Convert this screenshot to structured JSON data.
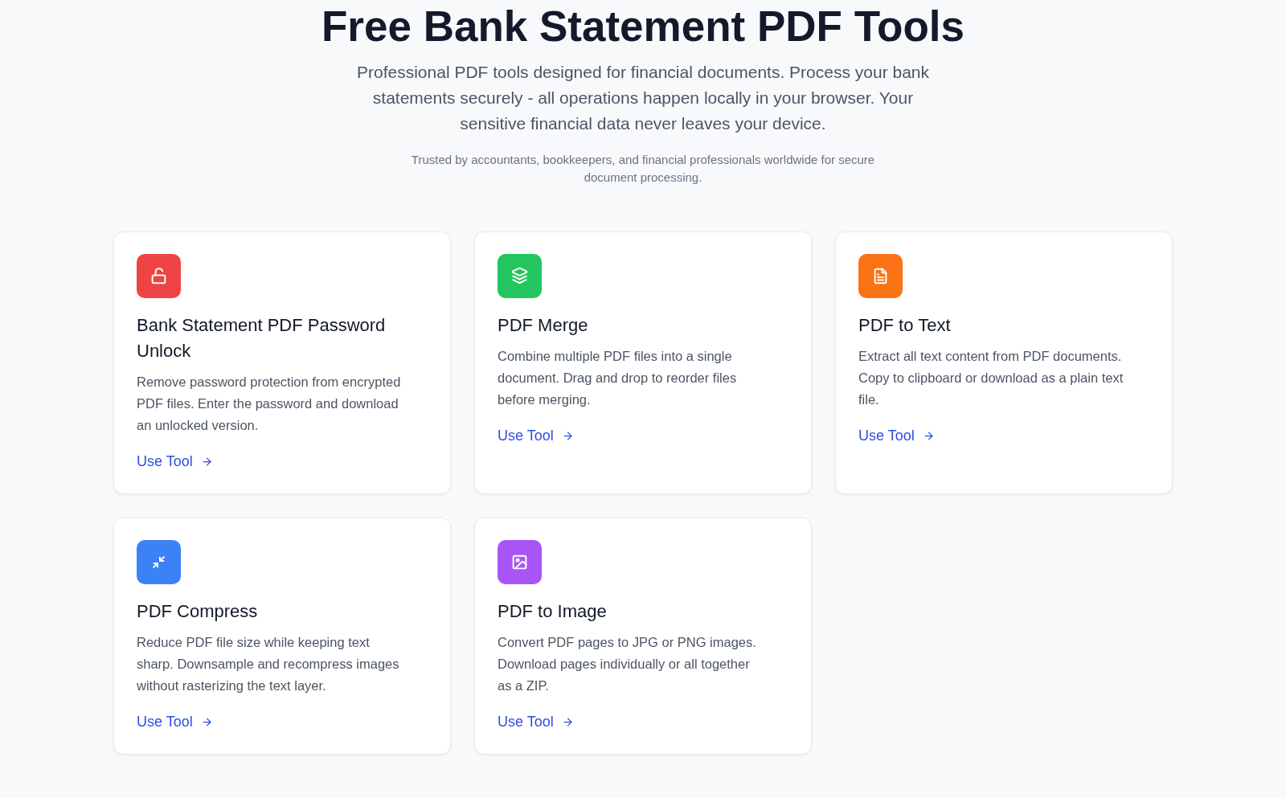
{
  "header": {
    "title": "Free Bank Statement PDF Tools",
    "subtitle": "Professional PDF tools designed for financial documents. Process your bank statements securely - all operations happen locally in your browser. Your sensitive financial data never leaves your device.",
    "note": "Trusted by accountants, bookkeepers, and financial professionals worldwide for secure document processing."
  },
  "tools": [
    {
      "kind": "unlock",
      "color": "#ef4444",
      "title": "Bank Statement PDF Password Unlock",
      "description": "Remove password protection from encrypted PDF files. Enter the password and download an unlocked version.",
      "link": "Use Tool"
    },
    {
      "kind": "merge",
      "color": "#22c55e",
      "title": "PDF Merge",
      "description": "Combine multiple PDF files into a single document. Drag and drop to reorder files before merging.",
      "link": "Use Tool"
    },
    {
      "kind": "extract",
      "color": "#f97316",
      "title": "PDF to Text",
      "description": "Extract all text content from PDF documents. Copy to clipboard or download as a plain text file.",
      "link": "Use Tool"
    },
    {
      "kind": "compress",
      "color": "#3b82f6",
      "title": "PDF Compress",
      "description": "Reduce PDF file size while keeping text sharp. Downsample and recompress images without rasterizing the text layer.",
      "link": "Use Tool"
    },
    {
      "kind": "convert",
      "color": "#a855f7",
      "title": "PDF to Image",
      "description": "Convert PDF pages to JPG or PNG images. Download pages individually or all together as a ZIP.",
      "link": "Use Tool"
    }
  ]
}
